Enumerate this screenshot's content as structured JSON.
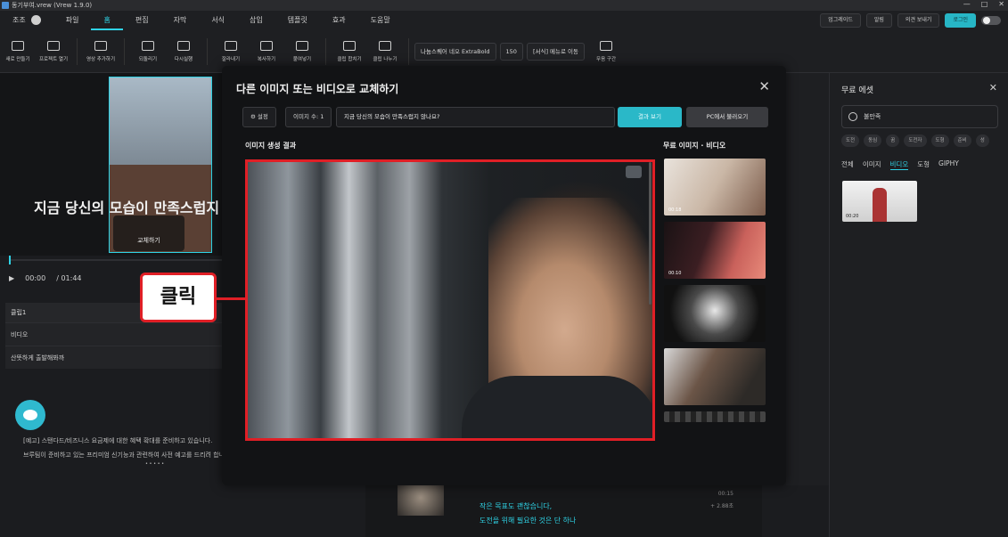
{
  "window": {
    "title": "동기부여.vrew (Vrew 1.9.0)",
    "controls": [
      "—",
      "□",
      "✕"
    ]
  },
  "menubar": {
    "items": [
      "조조",
      "파일",
      "홈",
      "편집",
      "자막",
      "서식",
      "삽입",
      "템플릿",
      "효과",
      "도움말"
    ],
    "active_index": 2,
    "right": {
      "upgrade": "업그레이드",
      "notifications": "알림",
      "feedback": "의견 보내기",
      "login": "로그인"
    }
  },
  "toolbar": {
    "items": [
      "새로 만들기",
      "프로젝트 열기",
      "영상 추가하기",
      "되돌리기",
      "다시실행",
      "잘라내기",
      "복사하기",
      "붙여넣기",
      "클립 합치기",
      "클립 나누기"
    ],
    "font": "나눔스퀘어 네오 ExtraBold",
    "font_size": "150",
    "move_to_format": "[서식] 메뉴로 이동",
    "silence": "무음 구간"
  },
  "preview": {
    "subtitle": "지금 당신의 모습이 만족스럽지",
    "replace_label": "교체하기",
    "time_current": "00:00",
    "time_total": "/ 01:44"
  },
  "clips": {
    "header": "클립1",
    "rows": [
      "비디오",
      "산뜻하게 출발해봐까"
    ]
  },
  "notice": {
    "line1": "[예고] 스탠다드/비즈니스 요금제에 대한 혜택 확대를 준비하고 있습니다.",
    "line2": "브루팀이 준비하고 있는 프리미엄 신기능과 관련하여 사전 예고를 드리려 합니다.",
    "dots": "• • • • •"
  },
  "modal": {
    "title": "다른 이미지 또는 비디오로 교체하기",
    "settings": "설정",
    "image_count": "이미지 수: 1",
    "prompt": "지금 당신의 모습이 만족스럽지 않나요?",
    "view_result": "결과 보기",
    "from_pc": "PC에서 불러오기",
    "generated_label": "이미지 생성 결과",
    "free_label": "무료 이미지 · 비디오",
    "free_items": [
      {
        "duration": "00:18"
      },
      {
        "duration": "00:10"
      },
      {
        "duration": ""
      },
      {
        "duration": ""
      }
    ]
  },
  "callout": {
    "label": "클릭"
  },
  "right_panel": {
    "title": "무료 에셋",
    "search_value": "불만족",
    "chips": [
      "도전",
      "동심",
      "꿈",
      "도전자",
      "도형",
      "준비",
      "성"
    ],
    "tabs": [
      "전체",
      "이미지",
      "비디오",
      "도형",
      "GIPHY"
    ],
    "active_tab": 2,
    "thumb_duration": "00:20"
  },
  "bottom_strip": {
    "line1": "작은 목표도 괜찮습니다,",
    "line2": "도전을 위해 필요한 것은 단 하나",
    "time1": "00:15",
    "time2": "+ 2.88초"
  },
  "colors": {
    "accent": "#2fd3e6",
    "highlight": "#e01f26"
  }
}
